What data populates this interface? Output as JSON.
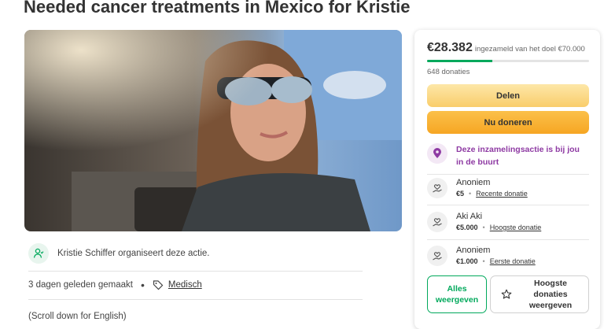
{
  "campaign": {
    "title": "Needed cancer treatments in Mexico for Kristie",
    "organizer_text": "Kristie Schiffer organiseert deze actie.",
    "created": "3 dagen geleden gemaakt",
    "category": "Medisch",
    "scroll_note": "(Scroll down for English)"
  },
  "donation_card": {
    "raised": "€28.382",
    "goal_text": "ingezameld van het doel €70.000",
    "progress_fraction": 0.405,
    "donations_count": "648 donaties",
    "share_label": "Delen",
    "donate_label": "Nu doneren",
    "nearby_text": "Deze inzamelingsactie is bij jou in de buurt",
    "donors": [
      {
        "name": "Anoniem",
        "amount": "€5",
        "tag": "Recente donatie"
      },
      {
        "name": "Aki Aki",
        "amount": "€5.000",
        "tag": "Hoogste donatie"
      },
      {
        "name": "Anoniem",
        "amount": "€1.000",
        "tag": "Eerste donatie"
      }
    ],
    "see_all_label": "Alles weergeven",
    "top_donations_label": "Hoogste donaties weergeven"
  },
  "colors": {
    "accent_green": "#02a95c",
    "donate_orange": "#f6a623",
    "share_yellow": "#f9cd6b",
    "nearby_purple": "#8e3aa3"
  },
  "icons": [
    "user-heart-icon",
    "tag-icon",
    "location-pin-icon",
    "hand-heart-icon",
    "star-icon"
  ]
}
